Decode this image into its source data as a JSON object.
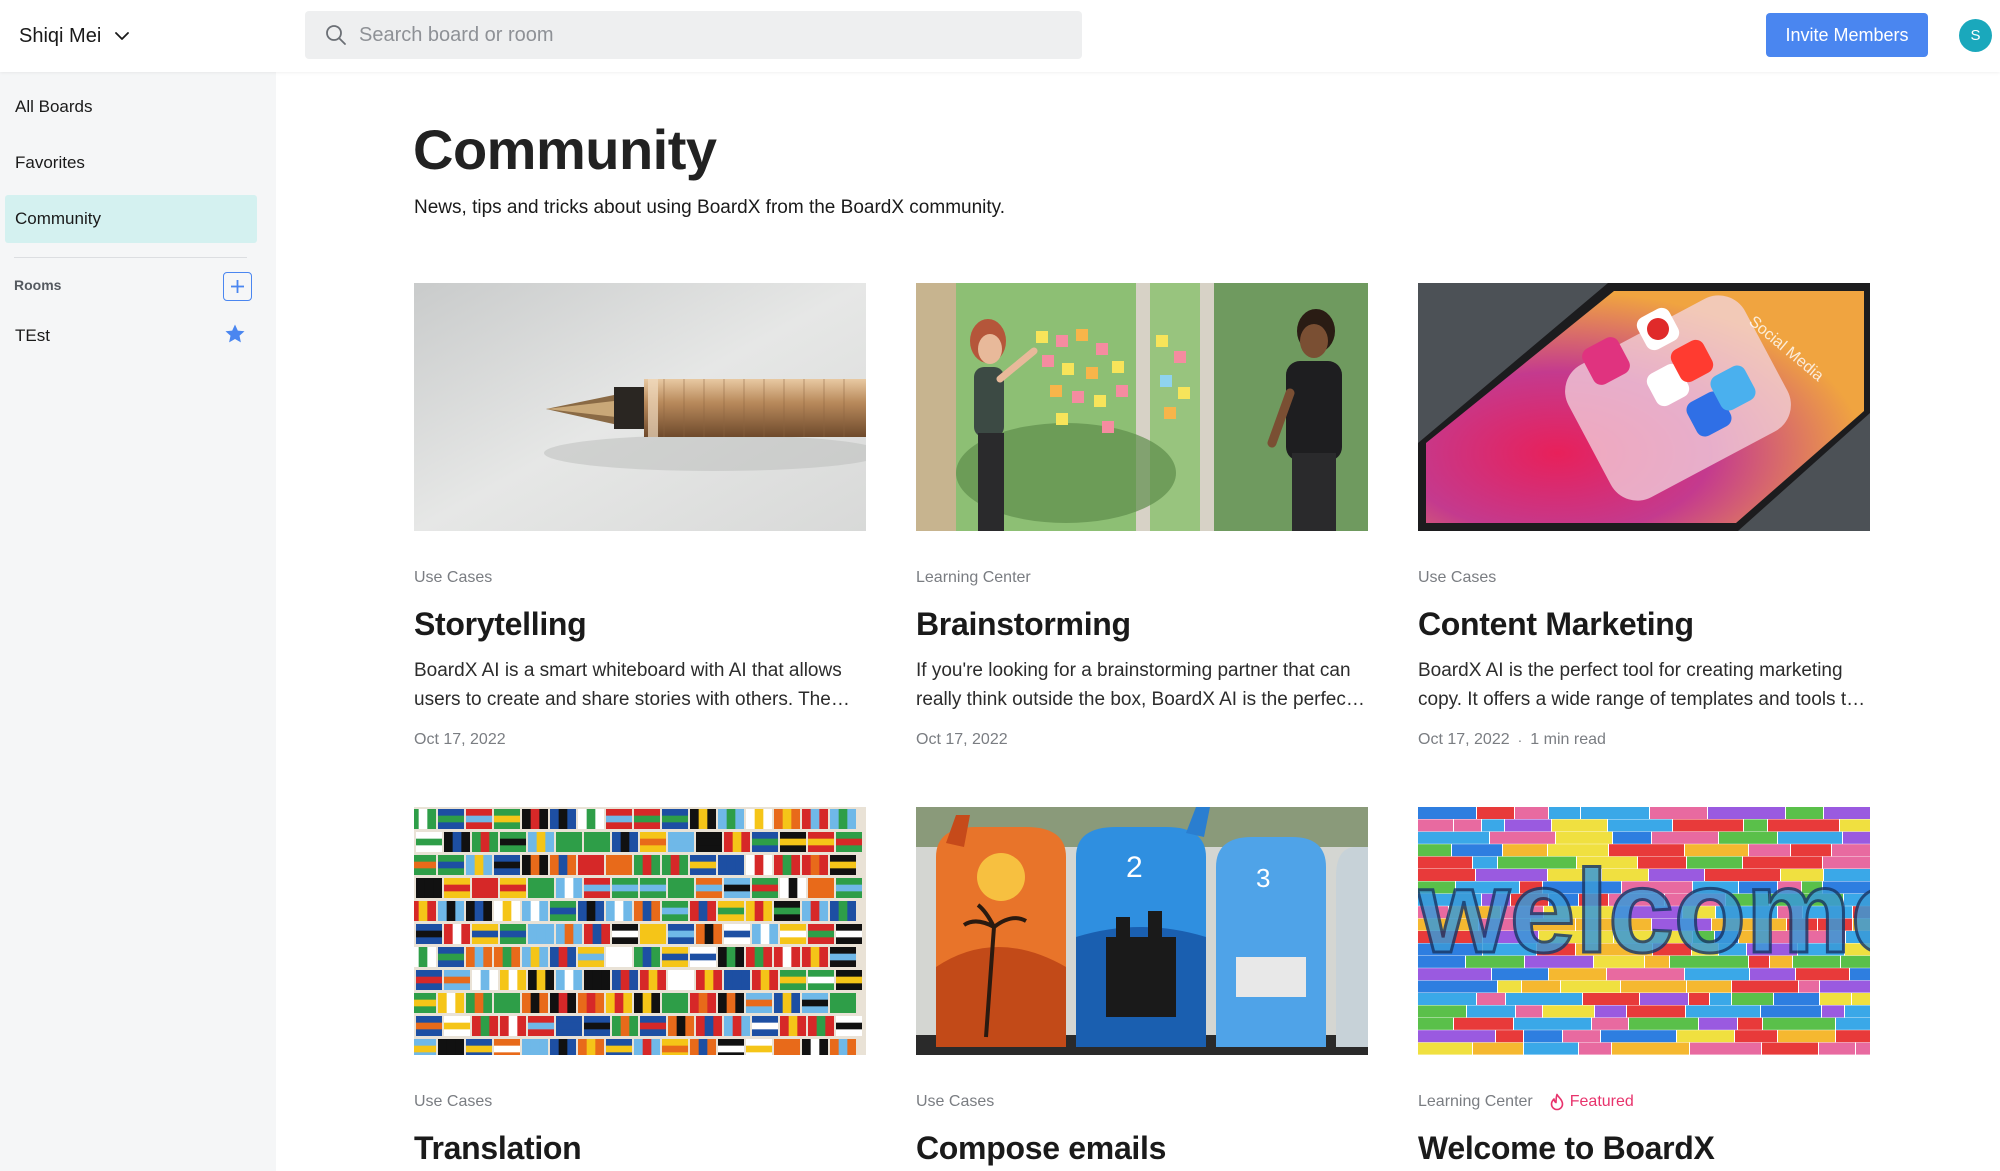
{
  "header": {
    "workspace_name": "Shiqi Mei",
    "search_placeholder": "Search board or room",
    "invite_label": "Invite Members",
    "avatar_initial": "S",
    "accent_color": "#4a86f0"
  },
  "sidebar": {
    "items": [
      {
        "label": "All Boards",
        "active": false
      },
      {
        "label": "Favorites",
        "active": false
      },
      {
        "label": "Community",
        "active": true
      }
    ],
    "rooms_label": "Rooms",
    "rooms": [
      {
        "label": "TEst",
        "favorite": true
      }
    ]
  },
  "main": {
    "title": "Community",
    "subtitle": "News, tips and tricks about using BoardX from the BoardX community.",
    "cards": [
      {
        "category": "Use Cases",
        "title": "Storytelling",
        "description": "BoardX AI is a smart whiteboard with AI that allows users to create and share stories with others. The platform is designed to help users collaborate and share ideas.",
        "date": "Oct 17, 2022",
        "read_time": "",
        "featured": "",
        "image": "fountain-pen"
      },
      {
        "category": "Learning Center",
        "title": "Brainstorming",
        "description": "If you're looking for a brainstorming partner that can really think outside the box, BoardX AI is the perfect companion for your team.",
        "date": "Oct 17, 2022",
        "read_time": "",
        "featured": "",
        "image": "sticky-notes-meeting"
      },
      {
        "category": "Use Cases",
        "title": "Content Marketing",
        "description": "BoardX AI is the perfect tool for creating marketing copy. It offers a wide range of templates and tools to help you write faster.",
        "date": "Oct 17, 2022",
        "read_time": "1 min read",
        "featured": "",
        "image": "social-media-phone"
      },
      {
        "category": "Use Cases",
        "title": "Translation",
        "description": "",
        "date": "",
        "read_time": "",
        "featured": "",
        "image": "world-flags"
      },
      {
        "category": "Use Cases",
        "title": "Compose emails",
        "description": "",
        "date": "",
        "read_time": "",
        "featured": "",
        "image": "painted-mailboxes"
      },
      {
        "category": "Learning Center",
        "title": "Welcome to BoardX",
        "description": "",
        "date": "",
        "read_time": "",
        "featured": "Featured",
        "image": "welcome-wall"
      }
    ]
  }
}
